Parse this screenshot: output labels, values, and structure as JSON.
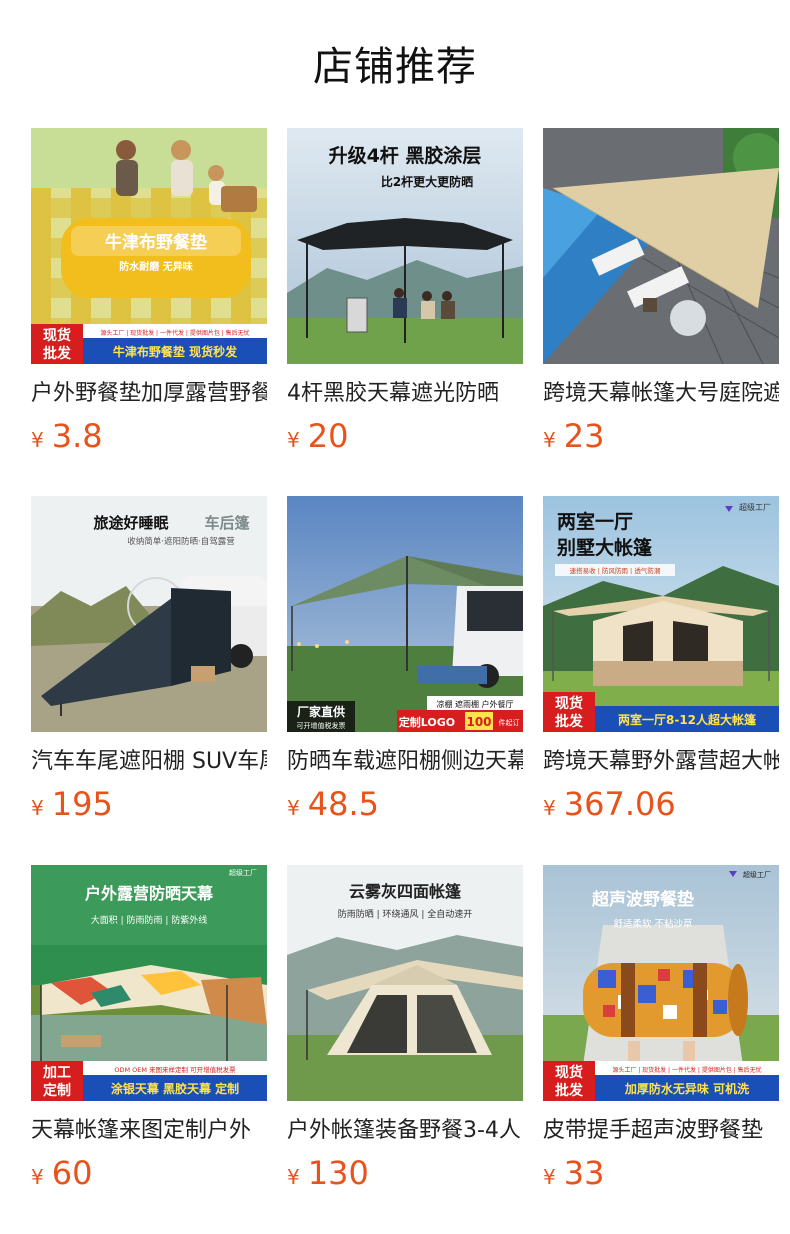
{
  "page": {
    "title": "店铺推荐"
  },
  "currency_symbol": "¥",
  "products": [
    {
      "name": "户外野餐垫加厚露营野餐垫",
      "price": "3.8",
      "image": {
        "icon": "picnic-mat-photo",
        "headline": "牛津布野餐垫",
        "sub": "防水耐磨  无异味",
        "badge_top": "现货",
        "badge_bottom": "批发",
        "banner_small": "源头工厂 | 现货批发 | 一件代发 | 提供图片包 | 售后无忧",
        "banner_big": "牛津布野餐垫  现货秒发",
        "colors": {
          "bg": "#b9d77a",
          "accent": "#f4c21c",
          "banner": "#1a4fb8"
        }
      }
    },
    {
      "name": "4杆黑胶天幕遮光防晒",
      "price": "20",
      "image": {
        "icon": "canopy-photo",
        "headline": "升级4杆  黑胶涂层",
        "sub": "比2杆更大更防晒",
        "colors": {
          "bg": "#c6d6e4",
          "accent": "#222222"
        }
      }
    },
    {
      "name": "跨境天幕帐篷大号庭院遮阳",
      "price": "23",
      "image": {
        "icon": "sun-shade-sail-photo",
        "colors": {
          "bg": "#3b8fd4",
          "accent": "#d9c59a"
        }
      }
    },
    {
      "name": "汽车车尾遮阳棚 SUV车尾帐",
      "price": "195",
      "image": {
        "icon": "car-awning-photo",
        "headline": "旅途好睡眠",
        "headline2": "车后篷",
        "sub": "收纳简单·遮阳防晒·自驾露营",
        "colors": {
          "bg": "#eef0f0",
          "accent": "#2d3b46"
        }
      }
    },
    {
      "name": "防晒车载遮阳棚侧边天幕",
      "price": "48.5",
      "image": {
        "icon": "car-side-awning-photo",
        "tag": "厂家直供",
        "tag_sub": "可开增值税发票",
        "badge_strip": "凉棚 遮雨棚 户外餐厅",
        "custom": "定制LOGO",
        "custom_num": "100",
        "custom_unit": "件起订",
        "colors": {
          "bg": "#5f86b8",
          "accent": "#4a7a4a"
        }
      }
    },
    {
      "name": "跨境天幕野外露营超大帐篷",
      "price": "367.06",
      "image": {
        "icon": "cabin-tent-photo",
        "headline": "两室一厅",
        "headline2": "别墅大帐篷",
        "factory": "超级工厂",
        "feature_chips": "速搭易收 | 防风防雨 | 透气防潮",
        "badge_top": "现货",
        "badge_bottom": "批发",
        "banner_big": "两室一厅8-12人超大帐篷",
        "colors": {
          "bg": "#8fb9d6",
          "accent": "#e8d2ae",
          "banner": "#1a4fb8"
        }
      }
    },
    {
      "name": "天幕帐篷来图定制户外",
      "price": "60",
      "image": {
        "icon": "custom-canopy-photo",
        "headline": "户外露营防晒天幕",
        "sub": "大面积 | 防雨防雨 | 防紫外线",
        "factory": "超级工厂",
        "badge_top": "加工",
        "badge_bottom": "定制",
        "banner_small": "ODM OEM  来图来样定制  可开增值税发票",
        "banner_big": "涂银天幕  黑胶天幕  定制",
        "colors": {
          "bg": "#2f8f4f",
          "accent": "#efe6cc",
          "banner": "#1a4fb8"
        }
      }
    },
    {
      "name": "户外帐篷装备野餐3-4人",
      "price": "130",
      "image": {
        "icon": "auto-tent-photo",
        "headline": "云雾灰四面帐篷",
        "sub": "防雨防晒 | 环绕通风 | 全自动速开",
        "colors": {
          "bg": "#eef1f2",
          "accent": "#e8dcc2"
        }
      }
    },
    {
      "name": "皮带提手超声波野餐垫",
      "price": "33",
      "image": {
        "icon": "rolled-mat-photo",
        "headline": "超声波野餐垫",
        "sub": "舒适柔软  不粘沙草",
        "factory": "超级工厂",
        "badge_top": "现货",
        "badge_bottom": "批发",
        "banner_small": "源头工厂 | 现货批发 | 一件代发 | 提供图片包 | 售后无忧",
        "banner_big": "加厚防水无异味  可机洗",
        "colors": {
          "bg": "#8fb0c8",
          "accent": "#e29a2e",
          "banner": "#1a4fb8"
        }
      }
    }
  ]
}
